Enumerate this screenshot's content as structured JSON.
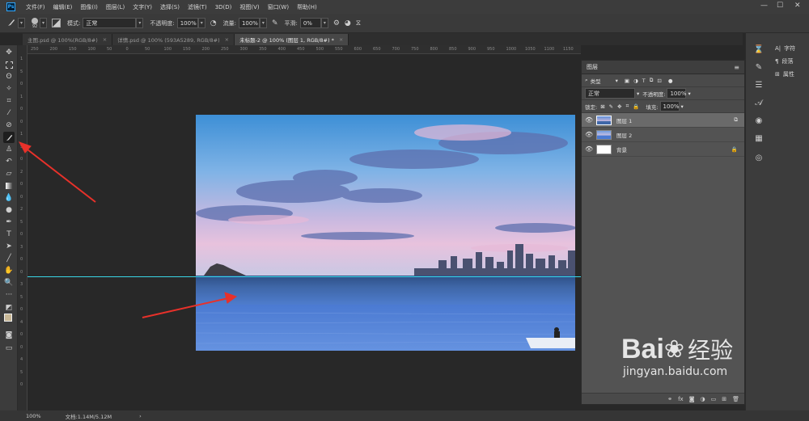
{
  "app": {
    "logo": "Ps"
  },
  "menu": [
    "文件(F)",
    "编辑(E)",
    "图像(I)",
    "图层(L)",
    "文字(Y)",
    "选择(S)",
    "滤镜(T)",
    "3D(D)",
    "视图(V)",
    "窗口(W)",
    "帮助(H)"
  ],
  "window_controls": [
    "—",
    "☐",
    "✕"
  ],
  "options": {
    "brush_size": "92",
    "mode_label": "模式:",
    "mode_value": "正常",
    "opacity_label": "不透明度:",
    "opacity_value": "100%",
    "flow_label": "流量:",
    "flow_value": "100%",
    "smooth_label": "平滑:",
    "smooth_value": "0%"
  },
  "tabs": [
    {
      "label": "主图.psd @ 100%(RGB/8#)",
      "close": "×"
    },
    {
      "label": "详情.psd @ 100% (593A5289, RGB/8#)",
      "close": "×"
    },
    {
      "label": "未标题-2 @ 100% (图层 1, RGB/8#) *",
      "close": "×"
    }
  ],
  "hruler_ticks": [
    "250",
    "200",
    "150",
    "100",
    "50",
    "0",
    "50",
    "100",
    "150",
    "200",
    "250",
    "300",
    "350",
    "400",
    "450",
    "500",
    "550",
    "600",
    "650",
    "700",
    "750",
    "800",
    "850",
    "900",
    "950",
    "1000",
    "1050",
    "1100",
    "1150"
  ],
  "vruler_ticks": [
    "1",
    "5",
    "0",
    "1",
    "0",
    "0",
    "1",
    "5",
    "0",
    "2",
    "0",
    "0",
    "2",
    "5",
    "0",
    "3",
    "0",
    "0",
    "3",
    "5",
    "0",
    "4",
    "0",
    "0",
    "4",
    "5",
    "0"
  ],
  "layers_panel": {
    "title": "图层",
    "filter_label": "类型",
    "blend_mode": "正常",
    "opacity_label": "不透明度:",
    "opacity_value": "100%",
    "lock_label": "锁定:",
    "fill_label": "填充:",
    "fill_value": "100%",
    "layers": [
      {
        "name": "图层 1",
        "active": true
      },
      {
        "name": "图层 2",
        "active": false
      },
      {
        "name": "背景",
        "active": false
      }
    ]
  },
  "right_dock": {
    "items": [
      {
        "icon": "A|",
        "label": "字符"
      },
      {
        "icon": "¶",
        "label": "段落"
      },
      {
        "icon": "⊞",
        "label": "属性"
      }
    ]
  },
  "status": {
    "zoom": "100%",
    "doc": "文档:1.14M/5.12M",
    "arrow": "›"
  },
  "watermark": {
    "brand": "Bai",
    "brand_cn": "经验",
    "url": "jingyan.baidu.com"
  },
  "colors": {
    "guide": "#3ad6e6",
    "annotation_arrow": "#e8312a",
    "panel_bg": "#535353"
  }
}
